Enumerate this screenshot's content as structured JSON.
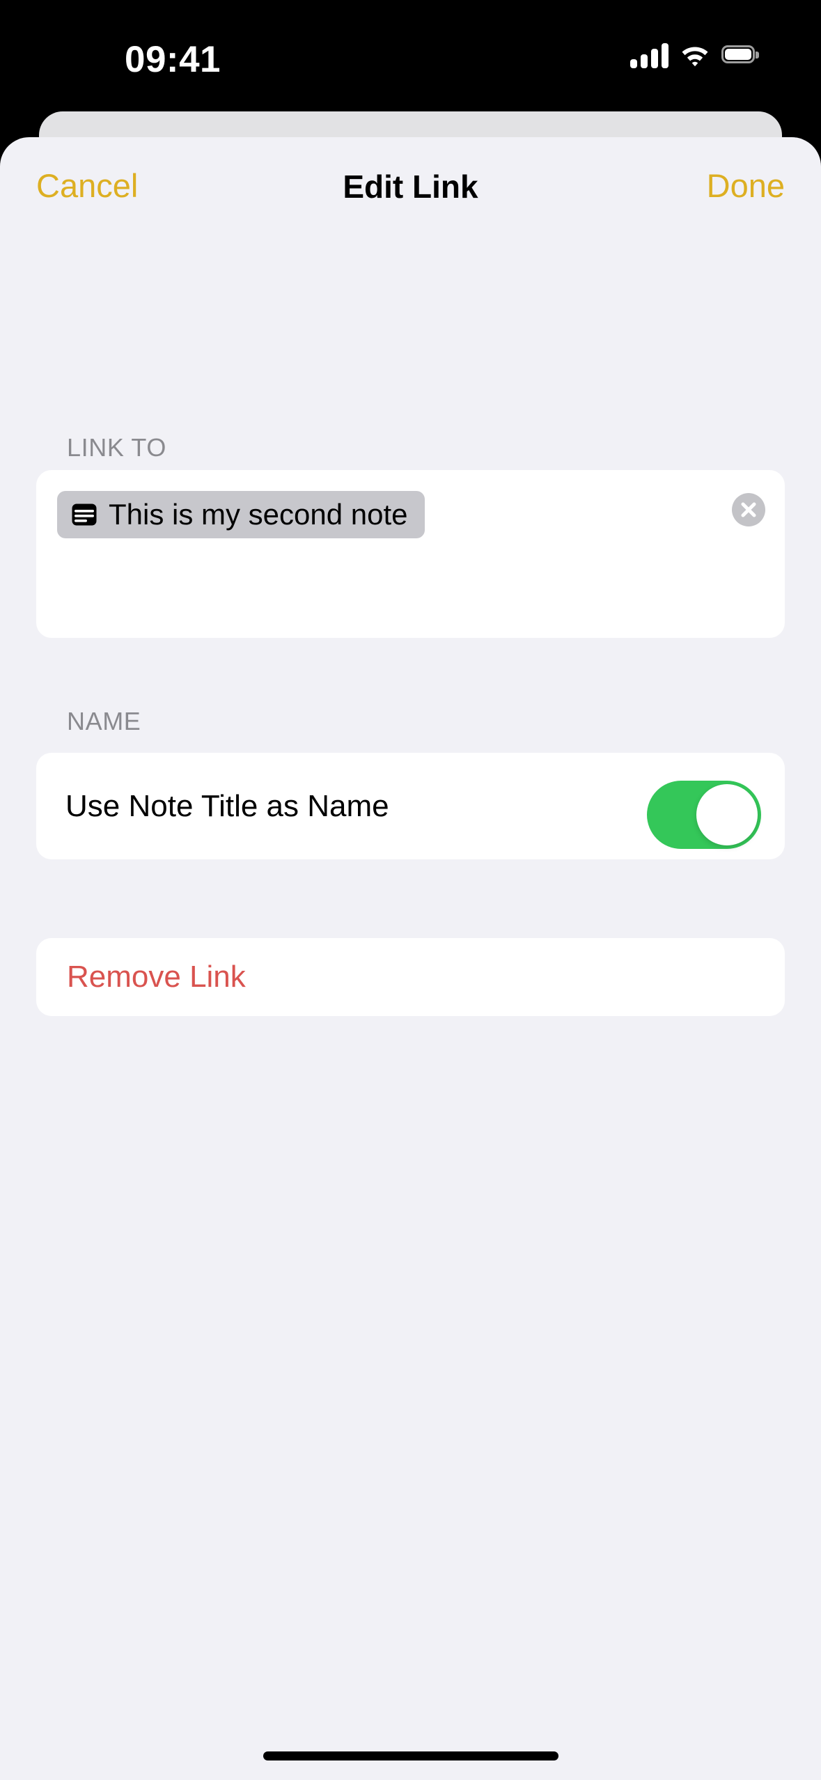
{
  "status_bar": {
    "time": "09:41",
    "cellular_icon": "cellular-signal-icon",
    "cellular_bars": 4,
    "wifi_icon": "wifi-icon",
    "battery_icon": "battery-full-icon"
  },
  "nav_bar": {
    "cancel_label": "Cancel",
    "title": "Edit Link",
    "done_label": "Done",
    "tint_color": "#DDAF22"
  },
  "sections": {
    "link_to": {
      "header": "LINK TO",
      "token": {
        "icon": "note-text-icon",
        "label": "This is my second note"
      },
      "clear_icon": "clear-circle-icon"
    },
    "name": {
      "header": "NAME",
      "row_label": "Use Note Title as Name",
      "toggle_state": "on",
      "toggle_on_color": "#34C759"
    },
    "remove": {
      "label": "Remove Link",
      "destructive_color": "#D9534F"
    }
  },
  "home_indicator": {
    "name": "home-indicator"
  }
}
